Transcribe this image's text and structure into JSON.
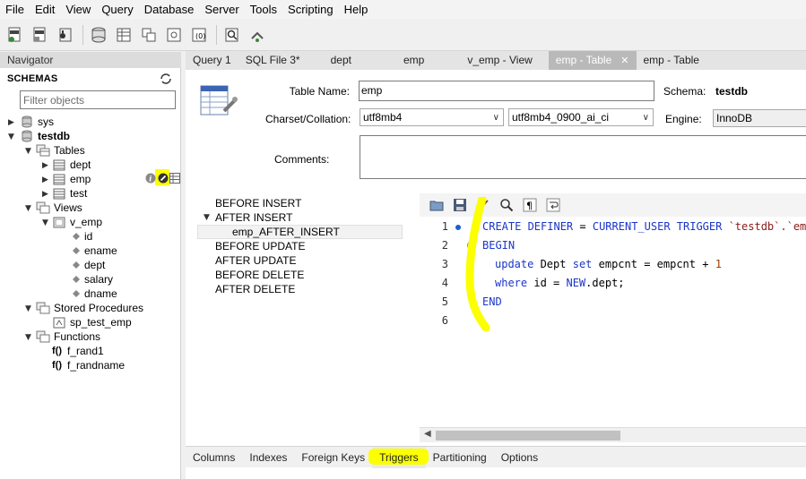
{
  "menu": [
    "File",
    "Edit",
    "View",
    "Query",
    "Database",
    "Server",
    "Tools",
    "Scripting",
    "Help"
  ],
  "navigator": {
    "title": "Navigator",
    "schemas_label": "SCHEMAS",
    "filter_placeholder": "Filter objects",
    "tree": {
      "sys": "sys",
      "testdb": "testdb",
      "tables": "Tables",
      "dept": "dept",
      "emp": "emp",
      "test": "test",
      "views": "Views",
      "v_emp": "v_emp",
      "cols": [
        "id",
        "ename",
        "dept",
        "salary",
        "dname"
      ],
      "stored_procedures": "Stored Procedures",
      "sp": "sp_test_emp",
      "functions": "Functions",
      "fn_prefix": "f()",
      "fn1": "f_rand1",
      "fn2": "f_randname"
    }
  },
  "tabs": [
    {
      "label": "Query 1"
    },
    {
      "label": "SQL File 3*"
    },
    {
      "label": "dept"
    },
    {
      "label": "emp"
    },
    {
      "label": "v_emp - View"
    },
    {
      "label": "emp - Table"
    },
    {
      "label": "emp - Table"
    }
  ],
  "tab_close": "✕",
  "table_form": {
    "table_name_label": "Table Name:",
    "table_name_value": "emp",
    "schema_label": "Schema:",
    "schema_value": "testdb",
    "charset_label": "Charset/Collation:",
    "charset_value": "utf8mb4",
    "collation_value": "utf8mb4_0900_ai_ci",
    "engine_label": "Engine:",
    "engine_value": "InnoDB",
    "comments_label": "Comments:"
  },
  "triggers": {
    "before_insert": "BEFORE INSERT",
    "after_insert": "AFTER INSERT",
    "selected": "emp_AFTER_INSERT",
    "before_update": "BEFORE UPDATE",
    "after_update": "AFTER UPDATE",
    "before_delete": "BEFORE DELETE",
    "after_delete": "AFTER DELETE"
  },
  "code": {
    "line_numbers": [
      "1",
      "2",
      "3",
      "4",
      "5",
      "6"
    ],
    "l1_kw1": "CREATE DEFINER",
    "l1_eq": " = ",
    "l1_kw2": "CURRENT_USER TRIGGER",
    "l1_sp": " ",
    "l1_str": "`testdb`.`emp_",
    "l2": "BEGIN",
    "l3_kw": "update",
    "l3_txt1": " Dept ",
    "l3_kw2": "set",
    "l3_txt2": " empcnt = empcnt + ",
    "l3_num": "1",
    "l4_kw": "where",
    "l4_txt": " id = ",
    "l4_kw2": "NEW",
    "l4_txt2": ".dept;",
    "l5": "END"
  },
  "bottom_tabs": [
    "Columns",
    "Indexes",
    "Foreign Keys",
    "Triggers",
    "Partitioning",
    "Options"
  ],
  "colors": {
    "highlight": "#fbff00",
    "keyword": "#1a36c9",
    "string": "#8b1a1a",
    "active_tab": "#b9b9b9"
  }
}
